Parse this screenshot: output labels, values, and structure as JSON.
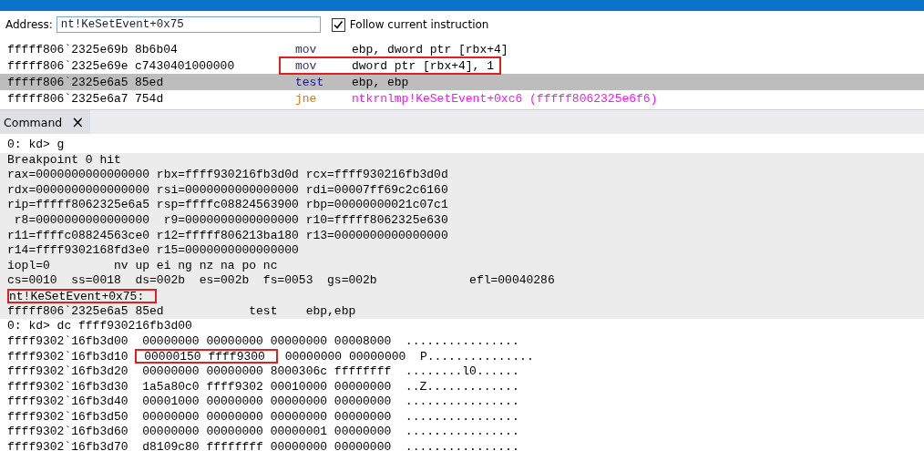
{
  "address_bar": {
    "label": "Address:",
    "value": "nt!KeSetEvent+0x75",
    "follow": {
      "label": "Follow current instruction",
      "checked": true
    }
  },
  "disassembly": [
    {
      "address": "fffff806`2325e69b",
      "bytes": "8b6b04",
      "mnemonic": "mov",
      "kind": "data",
      "operands": "ebp, dword ptr [rbx+4]",
      "selected": false,
      "boxed": false
    },
    {
      "address": "fffff806`2325e69e",
      "bytes": "c7430401000000",
      "mnemonic": "mov",
      "kind": "data",
      "operands": "dword ptr [rbx+4], 1",
      "selected": false,
      "boxed": true
    },
    {
      "address": "fffff806`2325e6a5",
      "bytes": "85ed",
      "mnemonic": "test",
      "kind": "compare",
      "operands": "ebp, ebp",
      "selected": true,
      "boxed": false
    },
    {
      "address": "fffff806`2325e6a7",
      "bytes": "754d",
      "mnemonic": "jne",
      "kind": "branch",
      "operands": "ntkrnlmp!KeSetEvent+0xc6 (fffff8062325e6f6)",
      "selected": false,
      "boxed": false
    }
  ],
  "tab": {
    "label": "Command",
    "close": "×"
  },
  "command_lines": [
    {
      "kind": "command",
      "segments": [
        {
          "text": "0: kd> g",
          "boxed": false
        }
      ]
    },
    {
      "kind": "output",
      "segments": [
        {
          "text": "Breakpoint 0 hit",
          "boxed": false
        }
      ]
    },
    {
      "kind": "output",
      "segments": [
        {
          "text": "rax=0000000000000000 rbx=ffff930216fb3d0d rcx=ffff930216fb3d0d",
          "boxed": false
        }
      ]
    },
    {
      "kind": "output",
      "segments": [
        {
          "text": "rdx=0000000000000000 rsi=0000000000000000 rdi=00007ff69c2c6160",
          "boxed": false
        }
      ]
    },
    {
      "kind": "output",
      "segments": [
        {
          "text": "rip=fffff8062325e6a5 rsp=ffffc08824563900 rbp=00000000021c07c1",
          "boxed": false
        }
      ]
    },
    {
      "kind": "output",
      "segments": [
        {
          "text": " r8=0000000000000000  r9=0000000000000000 r10=fffff8062325e630",
          "boxed": false
        }
      ]
    },
    {
      "kind": "output",
      "segments": [
        {
          "text": "r11=ffffc08824563ce0 r12=fffff806213ba180 r13=0000000000000000",
          "boxed": false
        }
      ]
    },
    {
      "kind": "output",
      "segments": [
        {
          "text": "r14=ffff9302168fd3e0 r15=0000000000000000",
          "boxed": false
        }
      ]
    },
    {
      "kind": "output",
      "segments": [
        {
          "text": "iopl=0         nv up ei ng nz na po nc",
          "boxed": false
        }
      ]
    },
    {
      "kind": "output",
      "segments": [
        {
          "text": "cs=0010  ss=0018  ds=002b  es=002b  fs=0053  gs=002b             efl=00040286",
          "boxed": false
        }
      ]
    },
    {
      "kind": "output",
      "segments": [
        {
          "text": "nt!KeSetEvent+0x75:",
          "boxed": true
        }
      ]
    },
    {
      "kind": "output",
      "segments": [
        {
          "text": "fffff806`2325e6a5 85ed            test    ebp,ebp",
          "boxed": false
        }
      ]
    },
    {
      "kind": "command",
      "segments": [
        {
          "text": "0: kd> dc ffff930216fb3d00",
          "boxed": false
        }
      ]
    },
    {
      "kind": "command",
      "segments": [
        {
          "text": "ffff9302`16fb3d00  00000000 00000000 00000000 00008000  ................",
          "boxed": false
        }
      ]
    },
    {
      "kind": "command",
      "segments": [
        {
          "text": "ffff9302`16fb3d10 ",
          "boxed": false
        },
        {
          "text": " 00000150 ffff9300",
          "boxed": true
        },
        {
          "text": " 00000000 00000000  P...............",
          "boxed": false
        }
      ]
    },
    {
      "kind": "command",
      "segments": [
        {
          "text": "ffff9302`16fb3d20  00000000 00000000 8000306c ffffffff  ........l0......",
          "boxed": false
        }
      ]
    },
    {
      "kind": "command",
      "segments": [
        {
          "text": "ffff9302`16fb3d30  1a5a80c0 ffff9302 00010000 00000000  ..Z.............",
          "boxed": false
        }
      ]
    },
    {
      "kind": "command",
      "segments": [
        {
          "text": "ffff9302`16fb3d40  00001000 00000000 00000000 00000000  ................",
          "boxed": false
        }
      ]
    },
    {
      "kind": "command",
      "segments": [
        {
          "text": "ffff9302`16fb3d50  00000000 00000000 00000000 00000000  ................",
          "boxed": false
        }
      ]
    },
    {
      "kind": "command",
      "segments": [
        {
          "text": "ffff9302`16fb3d60  00000000 00000000 00000001 00000000  ................",
          "boxed": false
        }
      ]
    },
    {
      "kind": "command",
      "segments": [
        {
          "text": "ffff9302`16fb3d70  d8109c80 ffffffff 00000000 00000000  ................",
          "boxed": false
        }
      ]
    }
  ]
}
